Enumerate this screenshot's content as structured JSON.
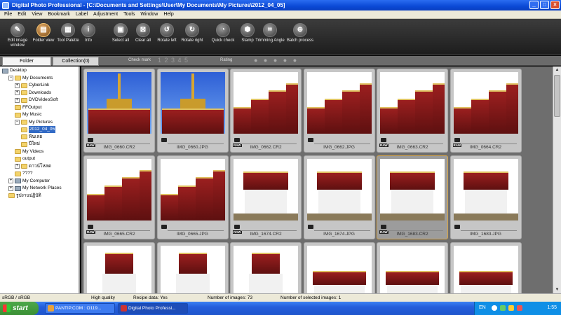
{
  "window": {
    "title": "Digital Photo Professional - [C:\\Documents and Settings\\User\\My Documents\\My Pictures\\2012_04_05]"
  },
  "menu": [
    "File",
    "Edit",
    "View",
    "Bookmark",
    "Label",
    "Adjustment",
    "Tools",
    "Window",
    "Help"
  ],
  "toolbar": [
    {
      "label": "Edit image window",
      "icon": "edit-image-icon"
    },
    {
      "label": "Folder view",
      "icon": "folder-view-icon",
      "active": true
    },
    {
      "label": "Tool Palette",
      "icon": "tool-palette-icon"
    },
    {
      "label": "Info",
      "icon": "info-icon"
    },
    {
      "label": "Select all",
      "icon": "select-all-icon"
    },
    {
      "label": "Clear all",
      "icon": "clear-all-icon"
    },
    {
      "label": "Rotate left",
      "icon": "rotate-left-icon"
    },
    {
      "label": "Rotate right",
      "icon": "rotate-right-icon"
    },
    {
      "label": "Quick check",
      "icon": "quick-check-icon"
    },
    {
      "label": "Stamp",
      "icon": "stamp-icon"
    },
    {
      "label": "Trimming Angle",
      "icon": "trimming-angle-icon"
    },
    {
      "label": "Batch process",
      "icon": "batch-process-icon"
    }
  ],
  "tabs": {
    "folder": "Folder",
    "collection": "Collection(0)",
    "check_mark": "Check mark",
    "check_mark_values": "1 2 3 4 5",
    "rating": "Rating",
    "rating_dots": "● ● ● ● ●"
  },
  "tree": [
    {
      "label": "Desktop",
      "level": 0,
      "icon": "desktop",
      "expander": ""
    },
    {
      "label": "My Documents",
      "level": 1,
      "icon": "folder",
      "expander": "−"
    },
    {
      "label": "CyberLink",
      "level": 2,
      "icon": "folder",
      "expander": "+"
    },
    {
      "label": "Downloads",
      "level": 2,
      "icon": "folder",
      "expander": "+"
    },
    {
      "label": "DVDVideoSoft",
      "level": 2,
      "icon": "folder",
      "expander": "+"
    },
    {
      "label": "FFOutput",
      "level": 2,
      "icon": "folder",
      "expander": ""
    },
    {
      "label": "My Music",
      "level": 2,
      "icon": "folder",
      "expander": ""
    },
    {
      "label": "My Pictures",
      "level": 2,
      "icon": "folder",
      "expander": "−"
    },
    {
      "label": "2012_04_05",
      "level": 3,
      "icon": "folder",
      "expander": "",
      "selected": true
    },
    {
      "label": "ฟินเลย",
      "level": 3,
      "icon": "folder",
      "expander": ""
    },
    {
      "label": "ปีใหม่",
      "level": 3,
      "icon": "folder",
      "expander": ""
    },
    {
      "label": "My Videos",
      "level": 2,
      "icon": "folder",
      "expander": ""
    },
    {
      "label": "output",
      "level": 2,
      "icon": "folder",
      "expander": ""
    },
    {
      "label": "ดาวน์โหลด",
      "level": 2,
      "icon": "folder",
      "expander": "+"
    },
    {
      "label": "????",
      "level": 2,
      "icon": "folder",
      "expander": ""
    },
    {
      "label": "My Computer",
      "level": 1,
      "icon": "pc",
      "expander": "+"
    },
    {
      "label": "My Network Places",
      "level": 1,
      "icon": "pc",
      "expander": "+"
    },
    {
      "label": "รูปงานปฏิบัติ",
      "level": 1,
      "icon": "folder",
      "expander": ""
    }
  ],
  "thumbnails": [
    {
      "name": "IMG_0660.CR2",
      "raw": true,
      "scene": "spire"
    },
    {
      "name": "IMG_0660.JPG",
      "raw": false,
      "scene": "spire"
    },
    {
      "name": "IMG_0662.CR2",
      "raw": true,
      "scene": "roofs"
    },
    {
      "name": "IMG_0662.JPG",
      "raw": false,
      "scene": "roofs"
    },
    {
      "name": "IMG_0663.CR2",
      "raw": true,
      "scene": "roofs"
    },
    {
      "name": "IMG_0664.CR2",
      "raw": true,
      "scene": "roofs"
    },
    {
      "name": "IMG_0665.CR2",
      "raw": true,
      "scene": "roofs"
    },
    {
      "name": "IMG_0665.JPG",
      "raw": false,
      "scene": "roofs"
    },
    {
      "name": "IMG_1674.CR2",
      "raw": true,
      "scene": "temple"
    },
    {
      "name": "IMG_1674.JPG",
      "raw": false,
      "scene": "temple"
    },
    {
      "name": "IMG_1683.CR2",
      "raw": true,
      "scene": "temple",
      "selected": true
    },
    {
      "name": "IMG_1683.JPG",
      "raw": false,
      "scene": "temple"
    },
    {
      "name": "",
      "raw": false,
      "scene": "tall"
    },
    {
      "name": "",
      "raw": false,
      "scene": "tall"
    },
    {
      "name": "",
      "raw": false,
      "scene": "tall"
    },
    {
      "name": "",
      "raw": false,
      "scene": "wide"
    },
    {
      "name": "",
      "raw": false,
      "scene": "wide"
    },
    {
      "name": "",
      "raw": false,
      "scene": "wide"
    }
  ],
  "status": {
    "color_space": "sRGB / sRGB",
    "quality": "High quality",
    "recipe": "Recipe data: Yes",
    "num_images": "Number of images: 73",
    "num_selected": "Number of selected images: 1"
  },
  "taskbar": {
    "start": "start",
    "tasks": [
      {
        "label": "PANTIP.COM : O119...",
        "active": false
      },
      {
        "label": "Digital Photo Professi...",
        "active": true
      }
    ],
    "lang": "EN",
    "time": "1:55"
  }
}
